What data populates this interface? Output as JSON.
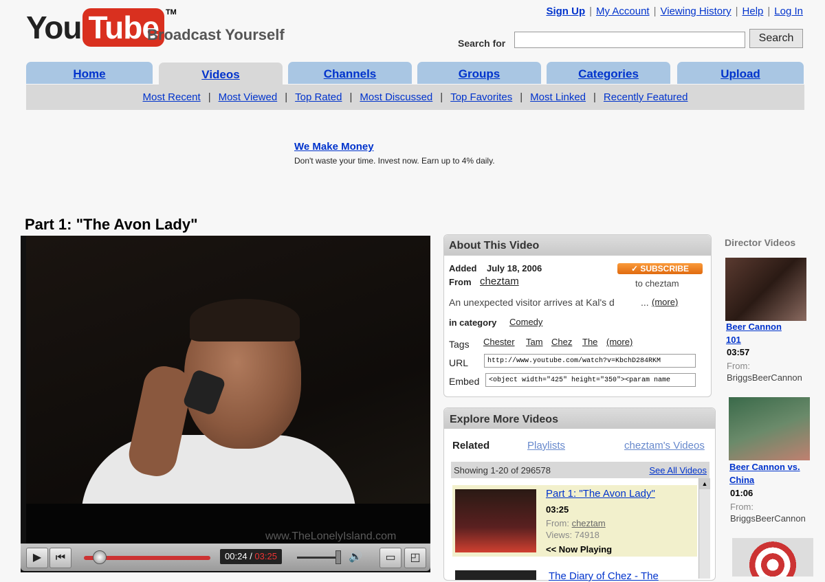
{
  "header": {
    "logo_you": "You",
    "logo_tube": "Tube",
    "logo_tm": "TM",
    "tagline": "Broadcast Yourself",
    "links": [
      "Sign Up",
      "My Account",
      "Viewing History",
      "Help",
      "Log In"
    ],
    "search_label": "Search for",
    "search_value": "",
    "search_button": "Search"
  },
  "nav": {
    "tabs": [
      "Home",
      "Videos",
      "Channels",
      "Groups",
      "Categories",
      "Upload"
    ],
    "active_tab": "Videos",
    "subnav": [
      "Most Recent",
      "Most Viewed",
      "Top Rated",
      "Most Discussed",
      "Top Favorites",
      "Most Linked",
      "Recently Featured"
    ]
  },
  "ad": {
    "title": "We Make Money",
    "text": "Don't waste your time. Invest now. Earn up to 4% daily."
  },
  "video": {
    "title": "Part 1: \"The Avon Lady\"",
    "watermark": "www.TheLonelyIsland.com",
    "current_time": "00:24",
    "separator": " / ",
    "total_time": "03:25",
    "progress": 0.12
  },
  "about": {
    "heading": "About This Video",
    "added_label": "Added",
    "added_date": "July 18, 2006",
    "from_label": "From",
    "from_user": "cheztam",
    "subscribe_label": "✓ SUBSCRIBE",
    "subscribe_to": "to cheztam",
    "description": "An unexpected visitor arrives at Kal's d",
    "ellipsis": "...",
    "more": "(more)",
    "category_label": "in category",
    "category": "Comedy",
    "tags_label": "Tags",
    "tags": [
      "Chester",
      "Tam",
      "Chez",
      "The"
    ],
    "tags_more": "(more)",
    "url_label": "URL",
    "url_value": "http://www.youtube.com/watch?v=KbchD284RKM",
    "embed_label": "Embed",
    "embed_value": "<object width=\"425\" height=\"350\"><param name"
  },
  "explore": {
    "heading": "Explore More Videos",
    "tabs": [
      "Related",
      "Playlists",
      "cheztam's Videos"
    ],
    "showing": "Showing 1-20 of 296578",
    "see_all": "See All Videos",
    "items": [
      {
        "title": "Part 1: \"The Avon Lady\"",
        "duration": "03:25",
        "from_label": "From:",
        "from": "cheztam",
        "views_label": "Views:",
        "views": "74918",
        "status": "<< Now Playing"
      }
    ],
    "next_title": "The Diary of Chez - The"
  },
  "director": {
    "heading": "Director Videos",
    "items": [
      {
        "title_1": "Beer Cannon",
        "title_2": "101",
        "duration": "03:57",
        "from_label": "From:",
        "from": "BriggsBeerCannon"
      },
      {
        "title_1": "Beer Cannon vs.",
        "title_2": "China",
        "duration": "01:06",
        "from_label": "From:",
        "from": "BriggsBeerCannon"
      }
    ]
  }
}
